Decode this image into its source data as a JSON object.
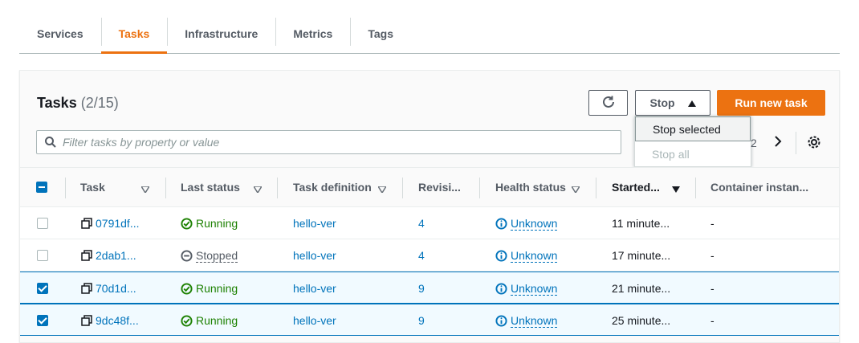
{
  "tabs": [
    {
      "label": "Services",
      "active": false
    },
    {
      "label": "Tasks",
      "active": true
    },
    {
      "label": "Infrastructure",
      "active": false
    },
    {
      "label": "Metrics",
      "active": false
    },
    {
      "label": "Tags",
      "active": false
    }
  ],
  "panel": {
    "title": "Tasks",
    "count": "(2/15)",
    "refresh_icon": "refresh-icon",
    "stop_label": "Stop",
    "run_label": "Run new task",
    "dropdown": {
      "stop_selected": "Stop selected",
      "stop_all": "Stop all"
    },
    "search_placeholder": "Filter tasks by property or value",
    "page_number": "2"
  },
  "colors": {
    "accent": "#ec7211",
    "link": "#0073bb",
    "running": "#1d8102"
  },
  "columns": [
    "Task",
    "Last status",
    "Task definition",
    "Revisi...",
    "Health status",
    "Started...",
    "Container instan..."
  ],
  "rows": [
    {
      "task": "0791df...",
      "status": "Running",
      "definition": "hello-ver",
      "revision": "4",
      "health": "Unknown",
      "started": "11 minute...",
      "container": "-",
      "selected": false
    },
    {
      "task": "2dab1...",
      "status": "Stopped",
      "definition": "hello-ver",
      "revision": "4",
      "health": "Unknown",
      "started": "17 minute...",
      "container": "-",
      "selected": false
    },
    {
      "task": "70d1d...",
      "status": "Running",
      "definition": "hello-ver",
      "revision": "9",
      "health": "Unknown",
      "started": "21 minute...",
      "container": "-",
      "selected": true
    },
    {
      "task": "9dc48f...",
      "status": "Running",
      "definition": "hello-ver",
      "revision": "9",
      "health": "Unknown",
      "started": "25 minute...",
      "container": "-",
      "selected": true
    }
  ]
}
